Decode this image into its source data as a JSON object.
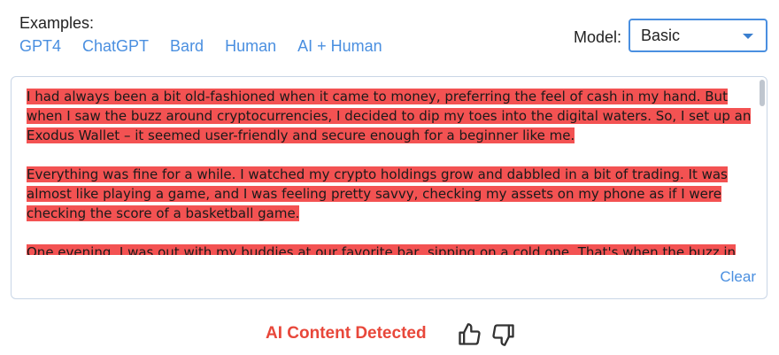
{
  "examples": {
    "label": "Examples:",
    "links": [
      "GPT4",
      "ChatGPT",
      "Bard",
      "Human",
      "AI + Human"
    ]
  },
  "model": {
    "label": "Model:",
    "selected": "Basic"
  },
  "text": {
    "highlight_color": "#f35252",
    "paragraphs": [
      "I had always been a bit old-fashioned when it came to money, preferring the feel of cash in my hand. But when I saw the buzz around cryptocurrencies, I decided to dip my toes into the digital waters. So, I set up an Exodus Wallet – it seemed user-friendly and secure enough for a beginner like me.",
      "Everything was fine for a while. I watched my crypto holdings grow and dabbled in a bit of trading. It was almost like playing a game, and I was feeling pretty savvy, checking my assets on my phone as if I were checking the score of a basketball game.",
      "One evening, I was out with my buddies at our favorite bar, sipping on a cold one. That's when the buzz in my"
    ]
  },
  "actions": {
    "clear_label": "Clear"
  },
  "result": {
    "status": "AI Content Detected",
    "status_color": "#e8473a",
    "thumbs_up_icon": "thumbs-up-icon",
    "thumbs_down_icon": "thumbs-down-icon"
  }
}
